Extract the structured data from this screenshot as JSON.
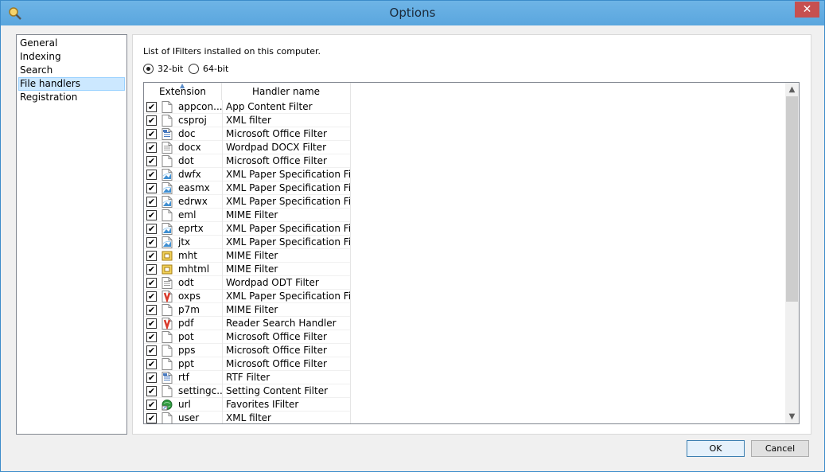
{
  "window": {
    "title": "Options",
    "close_glyph": "✕"
  },
  "nav": {
    "items": [
      {
        "label": "General",
        "selected": false
      },
      {
        "label": "Indexing",
        "selected": false
      },
      {
        "label": "Search",
        "selected": false
      },
      {
        "label": "File handlers",
        "selected": true
      },
      {
        "label": "Registration",
        "selected": false
      }
    ]
  },
  "panel": {
    "label": "List of IFilters installed on this computer.",
    "radio_32": {
      "label": "32-bit",
      "checked": true
    },
    "radio_64": {
      "label": "64-bit",
      "checked": false
    }
  },
  "list": {
    "columns": [
      "Extension",
      "Handler name"
    ],
    "rows": [
      {
        "ext": "appcon...",
        "handler": "App Content Filter",
        "icon": "blank-file-icon",
        "checked": true
      },
      {
        "ext": "csproj",
        "handler": "XML filter",
        "icon": "blank-file-icon",
        "checked": true
      },
      {
        "ext": "doc",
        "handler": "Microsoft Office Filter",
        "icon": "doc-file-icon",
        "checked": true
      },
      {
        "ext": "docx",
        "handler": "Wordpad DOCX Filter",
        "icon": "text-file-icon",
        "checked": true
      },
      {
        "ext": "dot",
        "handler": "Microsoft Office Filter",
        "icon": "blank-file-icon",
        "checked": true
      },
      {
        "ext": "dwfx",
        "handler": "XML Paper Specification Fil...",
        "icon": "xps-file-icon",
        "checked": true
      },
      {
        "ext": "easmx",
        "handler": "XML Paper Specification Fil...",
        "icon": "xps-file-icon",
        "checked": true
      },
      {
        "ext": "edrwx",
        "handler": "XML Paper Specification Fil...",
        "icon": "xps-file-icon",
        "checked": true
      },
      {
        "ext": "eml",
        "handler": "MIME Filter",
        "icon": "blank-file-icon",
        "checked": true
      },
      {
        "ext": "eprtx",
        "handler": "XML Paper Specification Fil...",
        "icon": "xps-file-icon",
        "checked": true
      },
      {
        "ext": "jtx",
        "handler": "XML Paper Specification Fil...",
        "icon": "xps-file-icon",
        "checked": true
      },
      {
        "ext": "mht",
        "handler": "MIME Filter",
        "icon": "mht-file-icon",
        "checked": true
      },
      {
        "ext": "mhtml",
        "handler": "MIME Filter",
        "icon": "mht-file-icon",
        "checked": true
      },
      {
        "ext": "odt",
        "handler": "Wordpad ODT Filter",
        "icon": "text-file-icon",
        "checked": true
      },
      {
        "ext": "oxps",
        "handler": "XML Paper Specification Fil...",
        "icon": "reader-file-icon",
        "checked": true
      },
      {
        "ext": "p7m",
        "handler": "MIME Filter",
        "icon": "blank-file-icon",
        "checked": true
      },
      {
        "ext": "pdf",
        "handler": "Reader Search Handler",
        "icon": "reader-file-icon",
        "checked": true
      },
      {
        "ext": "pot",
        "handler": "Microsoft Office Filter",
        "icon": "blank-file-icon",
        "checked": true
      },
      {
        "ext": "pps",
        "handler": "Microsoft Office Filter",
        "icon": "blank-file-icon",
        "checked": true
      },
      {
        "ext": "ppt",
        "handler": "Microsoft Office Filter",
        "icon": "blank-file-icon",
        "checked": true
      },
      {
        "ext": "rtf",
        "handler": "RTF Filter",
        "icon": "doc-file-icon",
        "checked": true
      },
      {
        "ext": "settingc...",
        "handler": "Setting Content Filter",
        "icon": "blank-file-icon",
        "checked": true
      },
      {
        "ext": "url",
        "handler": "Favorites IFilter",
        "icon": "url-file-icon",
        "checked": true
      },
      {
        "ext": "user",
        "handler": "XML filter",
        "icon": "blank-file-icon",
        "checked": true
      }
    ]
  },
  "buttons": {
    "ok": "OK",
    "cancel": "Cancel"
  }
}
